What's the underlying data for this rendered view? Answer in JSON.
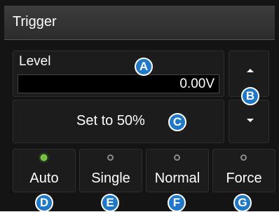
{
  "panel": {
    "title": "Trigger",
    "level": {
      "label": "Level",
      "value": "0.00V"
    },
    "set_to_50_label": "Set to 50%",
    "modes": [
      {
        "label": "Auto",
        "active": true
      },
      {
        "label": "Single",
        "active": false
      },
      {
        "label": "Normal",
        "active": false
      },
      {
        "label": "Force",
        "active": false
      }
    ]
  },
  "markers": [
    "A",
    "B",
    "C",
    "D",
    "E",
    "F",
    "G"
  ],
  "colors": {
    "marker_fill": "#1f78c8",
    "led_active": "#6fbf3a",
    "panel_bg": "#141414"
  },
  "icons": {
    "up": "arrow-up-icon",
    "down": "arrow-down-icon"
  }
}
